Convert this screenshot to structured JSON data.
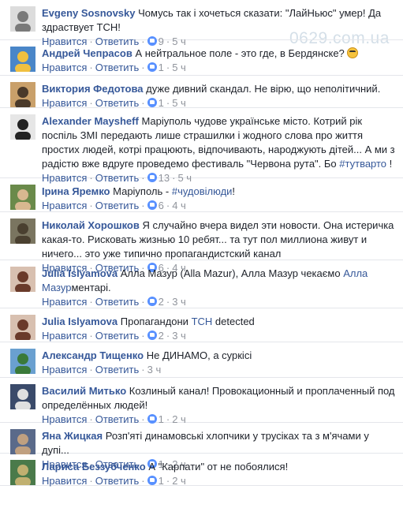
{
  "watermark": "0629.com.ua",
  "action_like": "Нравится",
  "action_reply": "Ответить",
  "comments": [
    {
      "author": "Evgeny Sosnovsky",
      "text": "Чомусь так і хочеться сказати: \"ЛайНьюс\" умер! Да здраствует ТСН!",
      "likes": "9",
      "time": "5 ч"
    },
    {
      "author": "Андрей Чепрасов",
      "text": "А нейтральное поле - это где, в Бердянске?",
      "likes": "1",
      "time": "5 ч",
      "emoji": "nerd-face-icon"
    },
    {
      "author": "Виктория Федотова",
      "text": "дуже дивний скандал. Не вірю, що неполітичний.",
      "likes": "1",
      "time": "5 ч"
    },
    {
      "author": "Alexander Maysheff",
      "text": "Маріуполь чудове українське місто. Котрий рік поспіль ЗМІ передають лише страшилки і жодного слова про життя простих людей, котрі працюють, відпочивають, народжують дітей... А ми з радістю вже вдруге проведемо фестиваль \"Червона рута\". Бо",
      "hashtag": "#тутварто",
      "text_after": " !",
      "likes": "13",
      "time": "5 ч"
    },
    {
      "author": "Iрина Яремко",
      "text": "Маріуполь -",
      "hashtag": "#чудовілюди",
      "text_after": "!",
      "likes": "6",
      "time": "4 ч"
    },
    {
      "author": "Николай Хорошков",
      "text": "Я случайно вчера видел эти новости. Она истеричка какая-то. Рисковать жизнью 10 ребят... та тут пол миллиона живут и ничего... это уже типично пропагандистский канал",
      "likes": "6",
      "time": "4 ч"
    },
    {
      "author": "Julia Islyamova",
      "text": "Алла Мазур (Alla Mazur), Алла Мазур чекаємо",
      "mention": "Алла Мазур",
      "text_after": "ментарі.",
      "likes": "2",
      "time": "3 ч"
    },
    {
      "author": "Julia Islyamova",
      "text": "Пропагандони",
      "mention": "ТСН",
      "text_after": " detected",
      "likes": "2",
      "time": "3 ч"
    },
    {
      "author": "Александр Тищенко",
      "text": "Не ДИНАМО, а суркісі",
      "likes": "",
      "time": "3 ч"
    },
    {
      "author": "Василий Митько",
      "text": "Козлиный канал! Провокационный и проплаченный под определённых людей!",
      "likes": "1",
      "time": "2 ч"
    },
    {
      "author": "Яна Жицкая",
      "text": "Розп'яті динамовські хлопчики у трусіках та з м'ячами у дупі...",
      "likes": "1",
      "time": "2 ч"
    },
    {
      "author": "Лариса Беззубченко",
      "text": "А \"Карпати\" от не побоялися!",
      "likes": "1",
      "time": "2 ч"
    }
  ]
}
